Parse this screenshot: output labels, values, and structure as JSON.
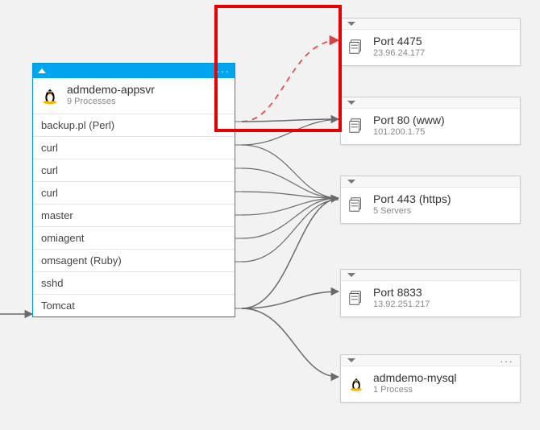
{
  "server": {
    "name": "admdemo-appsvr",
    "subtitle": "9 Processes",
    "processes": [
      "backup.pl (Perl)",
      "curl",
      "curl",
      "curl",
      "master",
      "omiagent",
      "omsagent (Ruby)",
      "sshd",
      "Tomcat"
    ]
  },
  "destinations": [
    {
      "title": "Port 4475",
      "sub": "23.96.24.177",
      "icon": "servers"
    },
    {
      "title": "Port 80 (www)",
      "sub": "101.200.1.75",
      "icon": "servers"
    },
    {
      "title": "Port 443 (https)",
      "sub": "5 Servers",
      "icon": "servers"
    },
    {
      "title": "Port 8833",
      "sub": "13.92.251.217",
      "icon": "servers"
    },
    {
      "title": "admdemo-mysql",
      "sub": "1 Process",
      "icon": "linux"
    }
  ],
  "chart_data": {
    "type": "diagram",
    "source_node": "admdemo-appsvr",
    "edges": [
      {
        "from_process": "backup.pl (Perl)",
        "to": "Port 4475",
        "style": "dashed-red",
        "note": "failed connection"
      },
      {
        "from_process": "backup.pl (Perl)",
        "to": "Port 80 (www)",
        "style": "solid"
      },
      {
        "from_process": "curl",
        "to": "Port 80 (www)",
        "style": "solid"
      },
      {
        "from_process": "curl",
        "to": "Port 443 (https)",
        "style": "solid"
      },
      {
        "from_process": "curl",
        "to": "Port 443 (https)",
        "style": "solid"
      },
      {
        "from_process": "master",
        "to": "Port 443 (https)",
        "style": "solid"
      },
      {
        "from_process": "omiagent",
        "to": "Port 443 (https)",
        "style": "solid"
      },
      {
        "from_process": "omsagent (Ruby)",
        "to": "Port 443 (https)",
        "style": "solid"
      },
      {
        "from_process": "Tomcat",
        "to": "Port 443 (https)",
        "style": "solid"
      },
      {
        "from_process": "Tomcat",
        "to": "Port 8833",
        "style": "solid"
      },
      {
        "from_process": "Tomcat",
        "to": "admdemo-mysql",
        "style": "solid"
      }
    ],
    "highlight_region": "top-right red box around failed connection to Port 4475 and connection to Port 80"
  }
}
